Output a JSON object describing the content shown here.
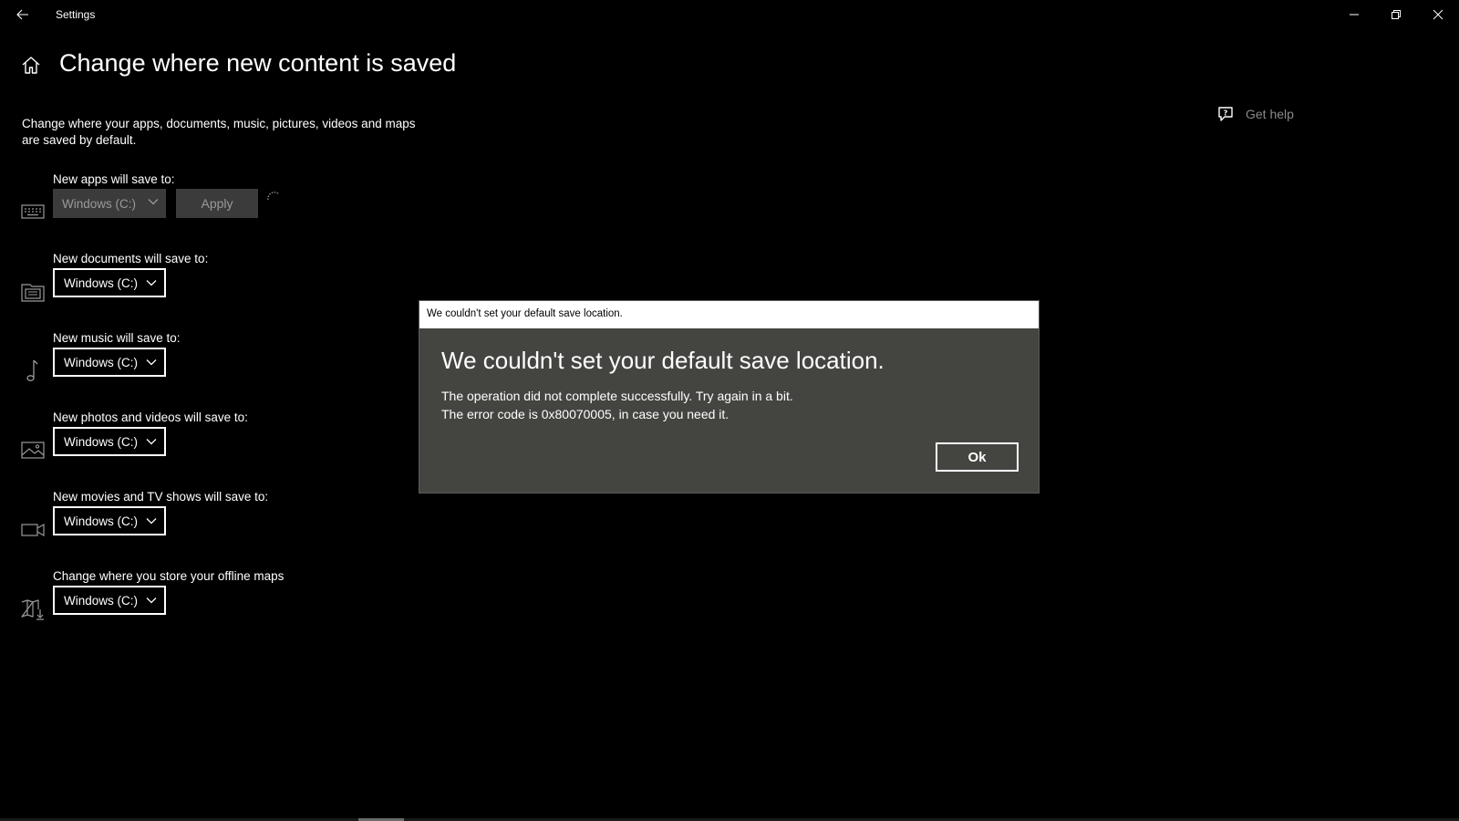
{
  "window": {
    "app_title": "Settings"
  },
  "header": {
    "page_title": "Change where new content is saved",
    "description": "Change where your apps, documents, music, pictures, videos and maps are saved by default."
  },
  "help": {
    "label": "Get help",
    "icon": "chat-help-icon"
  },
  "settings": [
    {
      "label": "New apps will save to:",
      "value": "Windows (C:)",
      "icon": "keyboard-icon",
      "disabled": true,
      "apply_label": "Apply"
    },
    {
      "label": "New documents will save to:",
      "value": "Windows (C:)",
      "icon": "documents-icon"
    },
    {
      "label": "New music will save to:",
      "value": "Windows (C:)",
      "icon": "music-note-icon"
    },
    {
      "label": "New photos and videos will save to:",
      "value": "Windows (C:)",
      "icon": "photo-icon"
    },
    {
      "label": "New movies and TV shows will save to:",
      "value": "Windows (C:)",
      "icon": "video-camera-icon"
    },
    {
      "label": "Change where you store your offline maps",
      "value": "Windows (C:)",
      "icon": "map-download-icon"
    }
  ],
  "dialog": {
    "window_title": "We couldn't set your default save location.",
    "heading": "We couldn't set your default save location.",
    "line1": "The operation did not complete successfully. Try again in a bit.",
    "line2": "The error code is 0x80070005, in case you need it.",
    "ok_label": "Ok"
  },
  "colors": {
    "background": "#000000",
    "dialog_bg": "#444441",
    "disabled_control": "#3b3b3b",
    "muted_text": "#8a8a8a"
  }
}
